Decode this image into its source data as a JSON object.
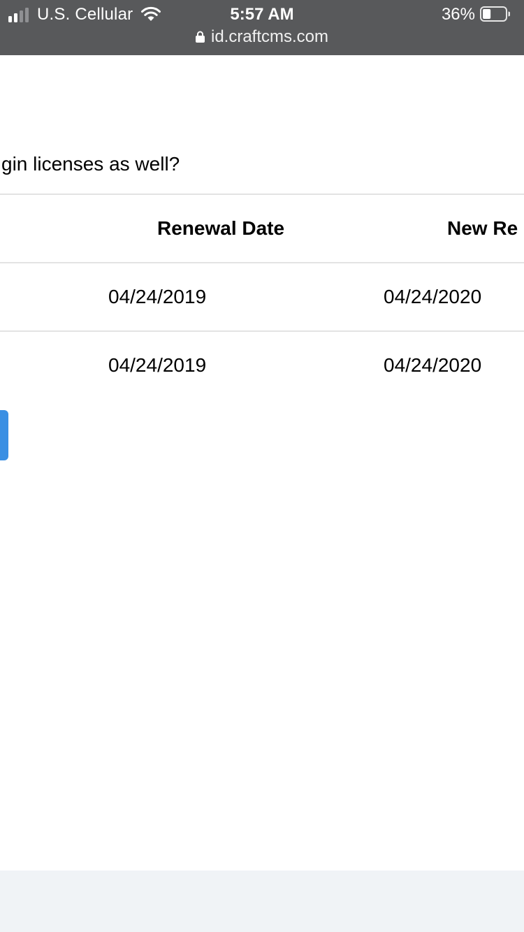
{
  "status_bar": {
    "carrier": "U.S. Cellular",
    "time": "5:57 AM",
    "battery_percent": "36%",
    "battery_level": 0.36,
    "url": "id.craftcms.com",
    "icons": [
      "signal-icon",
      "wifi-icon",
      "battery-icon",
      "lock-icon"
    ]
  },
  "content": {
    "question": "gin licenses as well?"
  },
  "table": {
    "headers": [
      "Renewal Date",
      "New Re"
    ],
    "rows": [
      [
        "04/24/2019",
        "04/24/2020"
      ],
      [
        "04/24/2019",
        "04/24/2020"
      ]
    ]
  },
  "colors": {
    "status_bar_bg": "#58595b",
    "button_blue": "#3a8fe3",
    "footer_bg": "#f0f3f6",
    "divider": "#e3e3e3"
  }
}
